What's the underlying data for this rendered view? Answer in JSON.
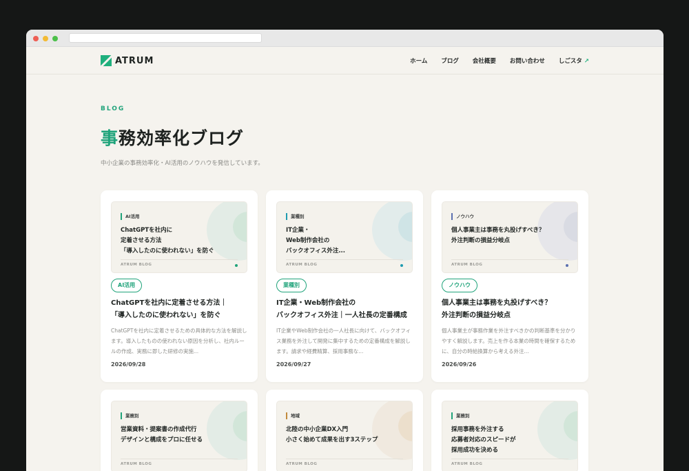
{
  "header": {
    "logo": "ATRUM",
    "nav": [
      "ホーム",
      "ブログ",
      "会社概要",
      "お問い合わせ"
    ],
    "cta_label": "しごスタ",
    "cta_icon": "↗"
  },
  "hero": {
    "kicker": "BLOG",
    "title_accent": "事",
    "title_rest": "務効率化ブログ",
    "subtitle": "中小企業の事務効率化・AI活用のノウハウを発信しています。"
  },
  "colors": {
    "green": "#1fa37a",
    "teal": "#1f9bb0",
    "indigo": "#5a6fb0",
    "amber": "#c28a3c"
  },
  "cards": [
    {
      "thumb_tag": "AI活用",
      "thumb_title": "ChatGPTを社内に\n定着させる方法\n「導入したのに使われない」を防ぐ",
      "thumb_footer": "ATRUM BLOG",
      "category": "AI活用",
      "title": "ChatGPTを社内に定着させる方法｜\n「導入したのに使われない」を防ぐ",
      "excerpt": "ChatGPTを社内に定着させるための具体的な方法を解説します。導入したものの使われない原因を分析し、社内ルールの作成、実務に即した研修の実施...",
      "date": "2026/09/28"
    },
    {
      "thumb_tag": "業種別",
      "thumb_title": "IT企業・\nWeb制作会社の\nバックオフィス外注...",
      "thumb_footer": "ATRUM BLOG",
      "category": "業種別",
      "title": "IT企業・Web制作会社の\nバックオフィス外注｜一人社長の定番構成",
      "excerpt": "IT企業やWeb制作会社の一人社長に向けて、バックオフィス業務を外注して開発に集中するための定番構成を解説します。請求や経費精算、採用事務な...",
      "date": "2026/09/27"
    },
    {
      "thumb_tag": "ノウハウ",
      "thumb_title": "個人事業主は事務を丸投げすべき？\n外注判断の損益分岐点",
      "thumb_footer": "ATRUM BLOG",
      "category": "ノウハウ",
      "title": "個人事業主は事務を丸投げすべき？\n外注判断の損益分岐点",
      "excerpt": "個人事業主が事務作業を外注すべきかの判断基準を分かりやすく解説します。売上を作る本業の時間を確保するために、自分の時給換算から考える外注...",
      "date": "2026/09/26"
    },
    {
      "thumb_tag": "業務別",
      "thumb_title": "営業資料・提案書の作成代行\nデザインと構成をプロに任せる",
      "thumb_footer": "ATRUM BLOG"
    },
    {
      "thumb_tag": "地域",
      "thumb_title": "北陸の中小企業DX入門\n小さく始めて成果を出す3ステップ",
      "thumb_footer": "ATRUM BLOG"
    },
    {
      "thumb_tag": "業務別",
      "thumb_title": "採用事務を外注する\n応募者対応のスピードが\n採用成功を決める",
      "thumb_footer": "ATRUM BLOG"
    }
  ]
}
